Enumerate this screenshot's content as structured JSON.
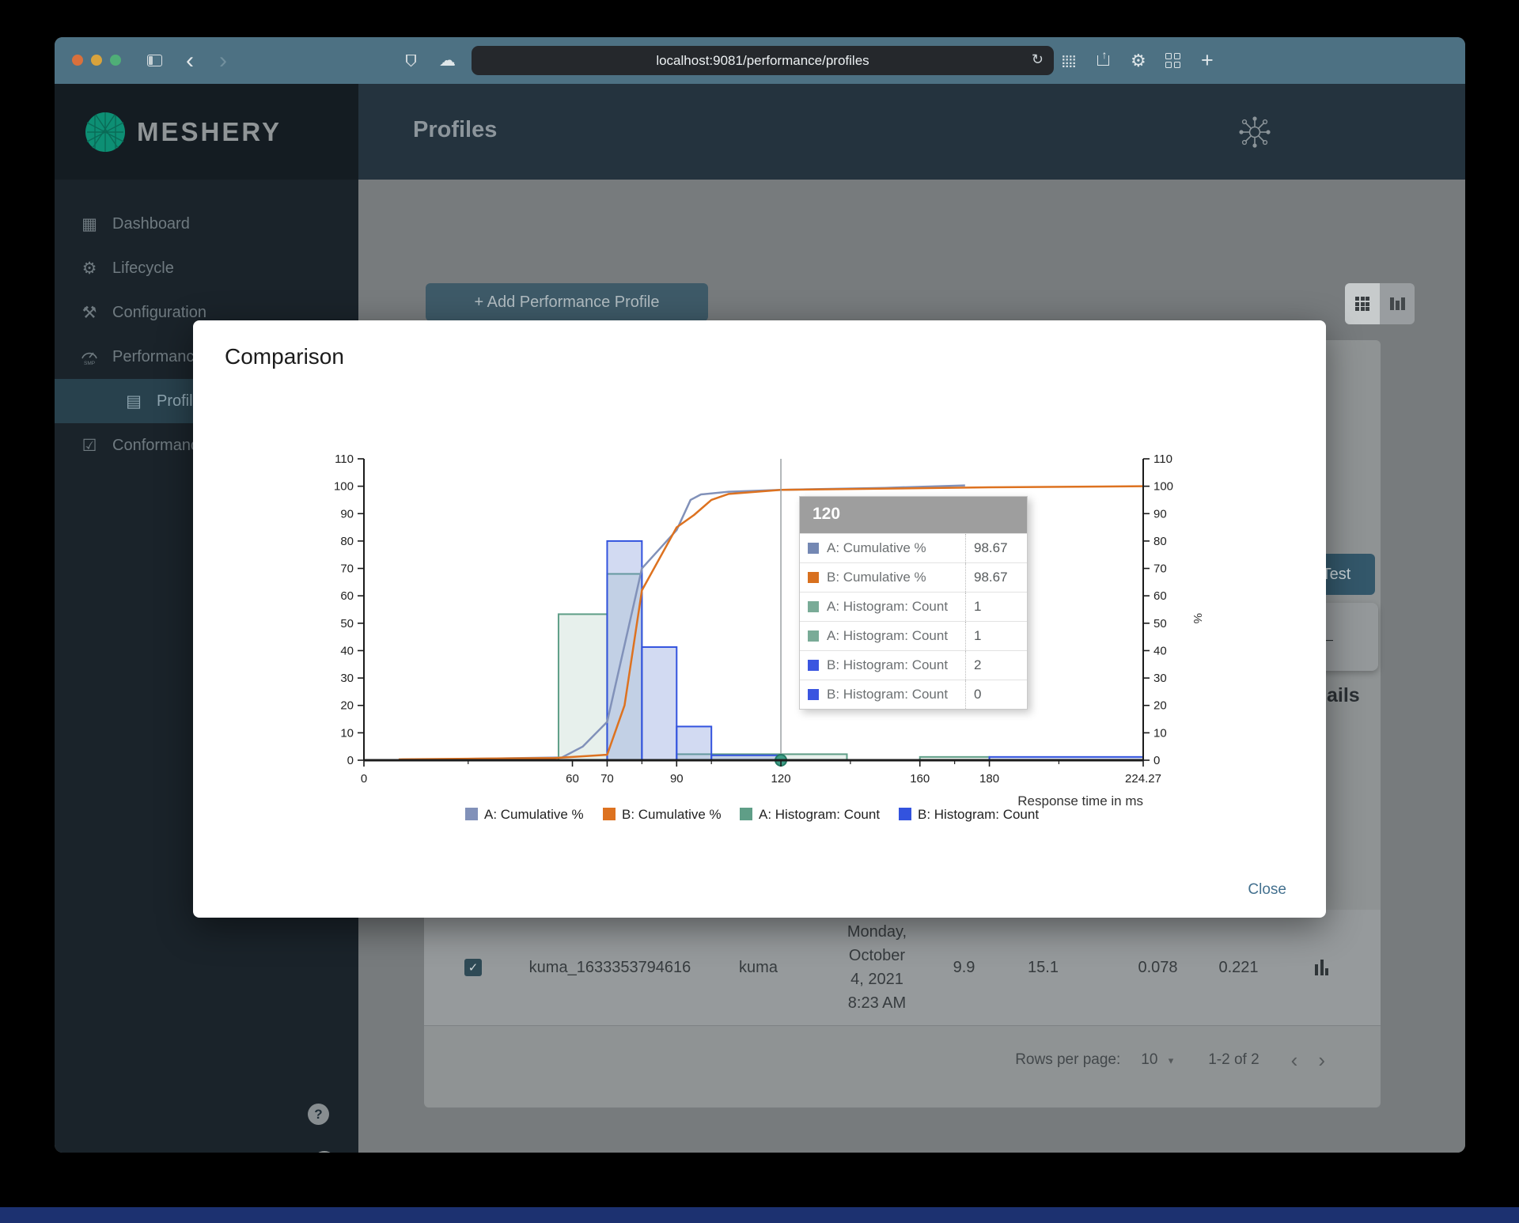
{
  "browser": {
    "url": "localhost:9081/performance/profiles",
    "traffic_lights": [
      "#d9703c",
      "#d9a33c",
      "#4fae77"
    ],
    "back": "‹",
    "forward": "›",
    "reload": "↻",
    "plus": "+",
    "cloud": "☁",
    "dots_grid": "⣿⣿",
    "gear": "⚙",
    "share_arrow": "↑"
  },
  "brand": {
    "name": "MESHERY"
  },
  "page": {
    "title": "Profiles"
  },
  "sidebar": {
    "items": [
      {
        "label": "Dashboard"
      },
      {
        "label": "Lifecycle"
      },
      {
        "label": "Configuration"
      },
      {
        "label": "Performance"
      },
      {
        "label": "Profiles"
      },
      {
        "label": "Conformance"
      }
    ],
    "help": "?",
    "collapse": "‹"
  },
  "main": {
    "add_profile_button": "+ Add Performance Profile",
    "test_button": "Test",
    "back_arrow": "←",
    "details_fragment": "ails",
    "table_row": {
      "name": "kuma_1633353794616",
      "mesh": "kuma",
      "date_lines": [
        "Monday,",
        "October",
        "4, 2021",
        "8:23 AM"
      ],
      "values": [
        "9.9",
        "15.1",
        "0.078",
        "0.221"
      ],
      "checkmark": "✓"
    },
    "pagination": {
      "rows_per_page_label": "Rows per page:",
      "rows_per_page_value": "10",
      "dropdown_arrow": "▾",
      "range": "1-2 of 2",
      "prev": "‹",
      "next": "›"
    }
  },
  "modal": {
    "title": "Comparison",
    "close_label": "Close"
  },
  "chart_data": {
    "type": "histogram+cumulative-line",
    "title": "",
    "xlabel": "Response time in ms",
    "ylabel_right": "%",
    "xlim": [
      0,
      224.27
    ],
    "ylim": [
      0,
      110
    ],
    "x_ticks": [
      0,
      60,
      70,
      90,
      120,
      160,
      180,
      224.27
    ],
    "x_minor_ticks": [
      30,
      80,
      100,
      140,
      170,
      200
    ],
    "y_tick_step": 10,
    "grid": false,
    "legend_position": "bottom",
    "series": [
      {
        "name": "A: Cumulative %",
        "type": "line",
        "color": "#8191b9",
        "points": [
          [
            30,
            0.5
          ],
          [
            57,
            1
          ],
          [
            63,
            5
          ],
          [
            70,
            14
          ],
          [
            80,
            70
          ],
          [
            90,
            84
          ],
          [
            94,
            95
          ],
          [
            97,
            97
          ],
          [
            105,
            98
          ],
          [
            120,
            98.67
          ],
          [
            150,
            99.4
          ],
          [
            173,
            100.3
          ]
        ]
      },
      {
        "name": "B: Cumulative %",
        "type": "line",
        "color": "#dd7220",
        "points": [
          [
            10,
            0.3
          ],
          [
            55,
            0.8
          ],
          [
            70,
            2
          ],
          [
            75,
            20
          ],
          [
            80,
            62
          ],
          [
            90,
            85
          ],
          [
            95,
            89.5
          ],
          [
            100,
            95
          ],
          [
            105,
            97.2
          ],
          [
            120,
            98.67
          ],
          [
            180,
            99.6
          ],
          [
            224.27,
            100
          ]
        ]
      },
      {
        "name": "A: Histogram: Count",
        "type": "bars",
        "color": "#5f9e87",
        "fill": "rgba(120,170,150,0.18)",
        "bins": [
          [
            56,
            70,
            53.3
          ],
          [
            70,
            80,
            68
          ],
          [
            90,
            139,
            2.2
          ],
          [
            160,
            180,
            1.2
          ]
        ]
      },
      {
        "name": "B: Histogram: Count",
        "type": "bars",
        "color": "#3353de",
        "fill": "rgba(115,140,215,0.32)",
        "bins": [
          [
            70,
            80,
            80
          ],
          [
            80,
            90,
            41.3
          ],
          [
            90,
            100,
            12.3
          ],
          [
            100,
            120,
            1.8
          ],
          [
            180,
            224.27,
            1.2
          ]
        ]
      }
    ],
    "crosshair_x": 120,
    "marker": {
      "x": 120,
      "y": 0,
      "color": "#3f9e87",
      "edge": "#237a64"
    },
    "tooltip": {
      "header": "120",
      "rows": [
        {
          "label": "A: Cumulative %",
          "value": "98.67",
          "color": "#7488b3"
        },
        {
          "label": "B: Cumulative %",
          "value": "98.67",
          "color": "#d8701f"
        },
        {
          "label": "A: Histogram: Count",
          "value": "1",
          "color": "#79ab97"
        },
        {
          "label": "A: Histogram: Count",
          "value": "1",
          "color": "#79ab97"
        },
        {
          "label": "B: Histogram: Count",
          "value": "2",
          "color": "#3a55e0"
        },
        {
          "label": "B: Histogram: Count",
          "value": "0",
          "color": "#3a55e0"
        }
      ]
    }
  }
}
